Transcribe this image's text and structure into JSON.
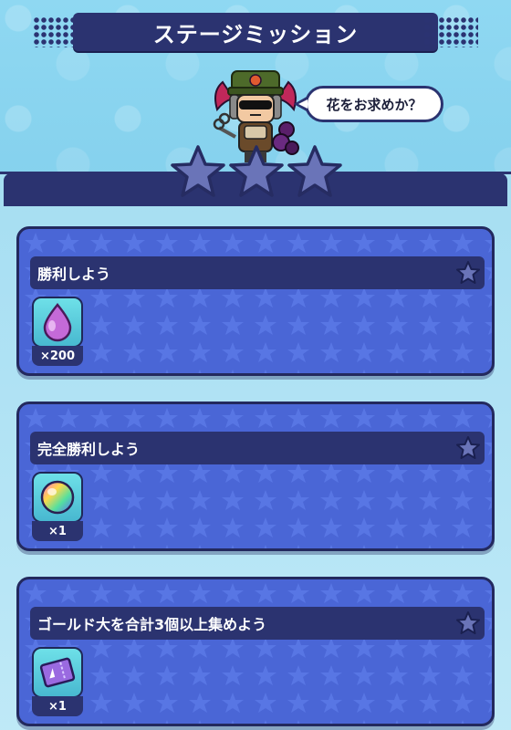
{
  "header": {
    "title": "ステージミッション"
  },
  "npc": {
    "speech": "花をお求めか？"
  },
  "stage_stars": {
    "earned": 0,
    "total": 3
  },
  "missions": [
    {
      "label": "勝利しよう",
      "reward_icon": "purple-drop-icon",
      "reward_count": "×200"
    },
    {
      "label": "完全勝利しよう",
      "reward_icon": "rainbow-orb-icon",
      "reward_count": "×1"
    },
    {
      "label": "ゴールド大を合計3個以上集めよう",
      "reward_icon": "purple-ticket-icon",
      "reward_count": "×1"
    }
  ],
  "colors": {
    "navy": "#2b3370",
    "card_blue": "#4a66d6",
    "background": "#8fd8f2",
    "star_slate": "#6a74b8"
  }
}
